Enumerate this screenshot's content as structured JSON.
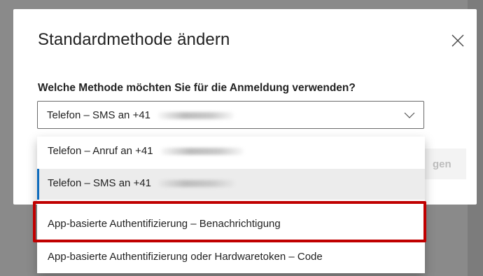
{
  "dialog": {
    "title": "Standardmethode ändern",
    "question": "Welche Methode möchten Sie für die Anmeldung verwenden?",
    "select_value": "Telefon – SMS an +41",
    "partial_button_text": "gen"
  },
  "dropdown": {
    "options": [
      {
        "label": "Telefon – Anruf an +41",
        "redacted": true
      },
      {
        "label": "Telefon – SMS an +41",
        "redacted": true,
        "selected": true
      },
      {
        "label": "App-basierte Authentifizierung – Benachrichtigung",
        "highlighted": true
      },
      {
        "label": "App-basierte Authentifizierung oder Hardwaretoken – Code"
      }
    ]
  },
  "colors": {
    "accent": "#0f6cbd",
    "highlight_border": "#c00000"
  },
  "icons": {
    "close": "close-icon",
    "chevron": "chevron-down-icon"
  }
}
